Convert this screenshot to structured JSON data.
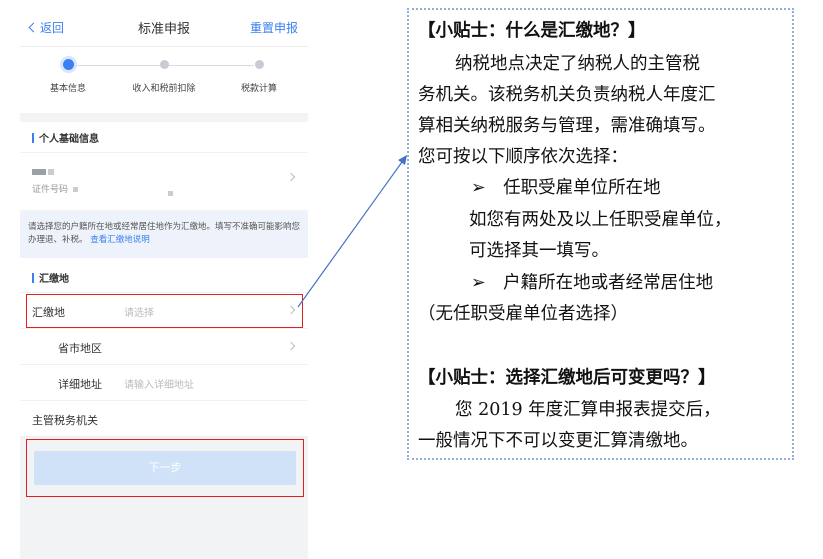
{
  "nav": {
    "back": "返回",
    "title": "标准申报",
    "reset": "重置申报"
  },
  "steps": [
    "基本信息",
    "收入和税前扣除",
    "税款计算"
  ],
  "personal": {
    "heading": "个人基础信息",
    "id_label": "证件号码"
  },
  "notice": {
    "text": "请选择您的户籍所在地或经常居住地作为汇缴地。填写不准确可能影响您办理退、补税。",
    "link": "查看汇缴地说明"
  },
  "remit": {
    "heading": "汇缴地",
    "place_label": "汇缴地",
    "place_placeholder": "请选择",
    "region_label": "省市地区",
    "address_label": "详细地址",
    "address_placeholder": "请输入详细地址",
    "tax_office_label": "主管税务机关"
  },
  "next_button": "下一步",
  "tips": {
    "line1": "【小贴士：什么是汇缴地？】",
    "line2": "纳税地点决定了纳税人的主管税",
    "line3": "务机关。该税务机关负责纳税人年度汇",
    "line4": "算相关纳税服务与管理，需准确填写。",
    "line5": "您可按以下顺序依次选择：",
    "bullet1": "➢　任职受雇单位所在地",
    "line7": "如您有两处及以上任职受雇单位，",
    "line8": "可选择其一填写。",
    "bullet2": "➢　户籍所在地或者经常居住地",
    "line10": "（无任职受雇单位者选择）",
    "line11": "【小贴士：选择汇缴地后可变更吗？】",
    "line12": "您 2019 年度汇算申报表提交后，",
    "line13": "一般情况下不可以变更汇算清缴地。"
  },
  "colors": {
    "accent": "#3b7ff3",
    "highlight_box": "#e02020",
    "tip_border": "#8fb0da"
  }
}
